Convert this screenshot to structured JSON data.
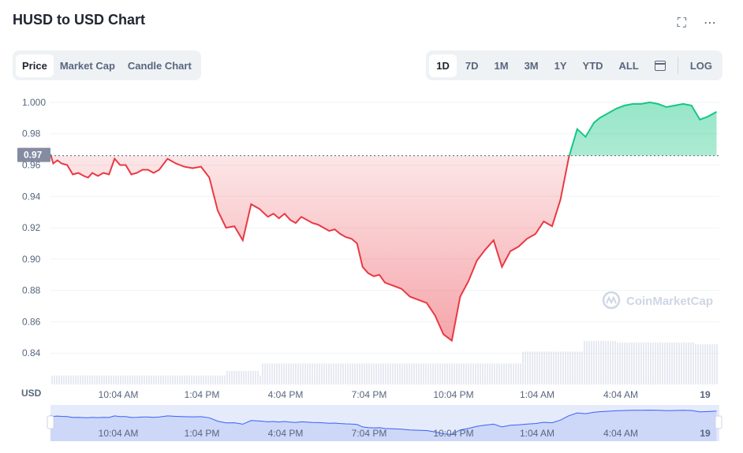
{
  "header": {
    "title": "HUSD to USD Chart",
    "fullscreen_icon": "fullscreen-icon",
    "more_icon": "more-icon"
  },
  "view_tabs": [
    {
      "label": "Price",
      "active": true
    },
    {
      "label": "Market Cap",
      "active": false
    },
    {
      "label": "Candle Chart",
      "active": false
    }
  ],
  "range_tabs": [
    {
      "label": "1D",
      "active": true
    },
    {
      "label": "7D",
      "active": false
    },
    {
      "label": "1M",
      "active": false
    },
    {
      "label": "3M",
      "active": false
    },
    {
      "label": "1Y",
      "active": false
    },
    {
      "label": "YTD",
      "active": false
    },
    {
      "label": "ALL",
      "active": false
    }
  ],
  "calendar_icon": "calendar-icon",
  "log_label": "LOG",
  "colors": {
    "up": "#16c784",
    "down": "#ea3943",
    "navigator": "#3861fb",
    "axis_text": "#58667e",
    "grid": "#eff2f5"
  },
  "chart_data": {
    "type": "line",
    "title": "HUSD to USD Chart",
    "currency_label": "USD",
    "current_price_label": "0.97",
    "reference_price": 0.966,
    "yticks": [
      "1.000",
      "0.98",
      "0.96",
      "0.94",
      "0.92",
      "0.90",
      "0.88",
      "0.86",
      "0.84"
    ],
    "ylim": [
      0.82,
      1.006
    ],
    "xticks": [
      "10:04 AM",
      "1:04 PM",
      "4:04 PM",
      "7:04 PM",
      "10:04 PM",
      "1:04 AM",
      "4:04 AM",
      "19"
    ],
    "x_unit": "hours from 10:04 AM",
    "xlim": [
      -1.7,
      22.3
    ],
    "grid": true,
    "watermark": "CoinMarketCap",
    "series": [
      {
        "x": [
          -1.7,
          -1.6,
          -1.45,
          -1.3,
          -1.1,
          -0.9,
          -0.7,
          -0.5,
          -0.35,
          -0.2,
          0,
          0.2,
          0.4,
          0.6,
          0.8,
          1.0,
          1.2,
          1.4,
          1.6,
          1.8,
          2.0,
          2.2,
          2.5,
          2.8,
          3.1,
          3.4,
          3.7,
          4.0,
          4.3,
          4.6,
          4.9,
          5.2,
          5.5,
          5.8,
          6.1,
          6.3,
          6.5,
          6.7,
          6.9,
          7.1,
          7.3,
          7.5,
          7.7,
          7.9,
          8.1,
          8.3,
          8.5,
          8.7,
          8.9,
          9.1,
          9.3,
          9.5,
          9.7,
          9.9,
          10.1,
          10.3,
          10.6,
          10.9,
          11.2,
          11.5,
          11.8,
          12.1,
          12.4,
          12.7,
          13.0,
          13.3,
          13.6,
          13.9,
          14.2,
          14.5,
          14.8,
          15.1,
          15.4,
          15.7,
          16.0,
          16.3,
          16.6,
          16.9,
          17.2,
          17.5,
          17.8,
          18.0,
          18.3,
          18.6,
          18.9,
          19.2,
          19.5,
          19.8,
          20.1,
          20.4,
          20.7,
          21.0,
          21.3,
          21.6,
          21.9,
          22.2
        ],
        "y": [
          0.967,
          0.961,
          0.963,
          0.961,
          0.96,
          0.954,
          0.955,
          0.953,
          0.952,
          0.955,
          0.953,
          0.955,
          0.954,
          0.964,
          0.96,
          0.96,
          0.954,
          0.955,
          0.957,
          0.957,
          0.955,
          0.957,
          0.964,
          0.961,
          0.959,
          0.958,
          0.959,
          0.952,
          0.931,
          0.92,
          0.921,
          0.912,
          0.935,
          0.932,
          0.927,
          0.929,
          0.926,
          0.929,
          0.925,
          0.923,
          0.927,
          0.925,
          0.923,
          0.922,
          0.92,
          0.918,
          0.919,
          0.916,
          0.914,
          0.913,
          0.91,
          0.895,
          0.891,
          0.889,
          0.89,
          0.885,
          0.883,
          0.881,
          0.876,
          0.874,
          0.872,
          0.864,
          0.852,
          0.848,
          0.876,
          0.886,
          0.899,
          0.906,
          0.912,
          0.895,
          0.905,
          0.908,
          0.913,
          0.916,
          0.924,
          0.921,
          0.938,
          0.965,
          0.983,
          0.978,
          0.987,
          0.99,
          0.993,
          0.996,
          0.998,
          0.999,
          0.999,
          1.0,
          0.999,
          0.997,
          0.998,
          0.999,
          0.998,
          0.989,
          0.991,
          0.994
        ]
      }
    ],
    "volume_bars": "grey bars along bottom, rising after 1:04 AM",
    "navigator_labels": [
      "10:04 AM",
      "1:04 PM",
      "4:04 PM",
      "7:04 PM",
      "10:04 PM",
      "1:04 AM",
      "4:04 AM",
      "19"
    ]
  }
}
